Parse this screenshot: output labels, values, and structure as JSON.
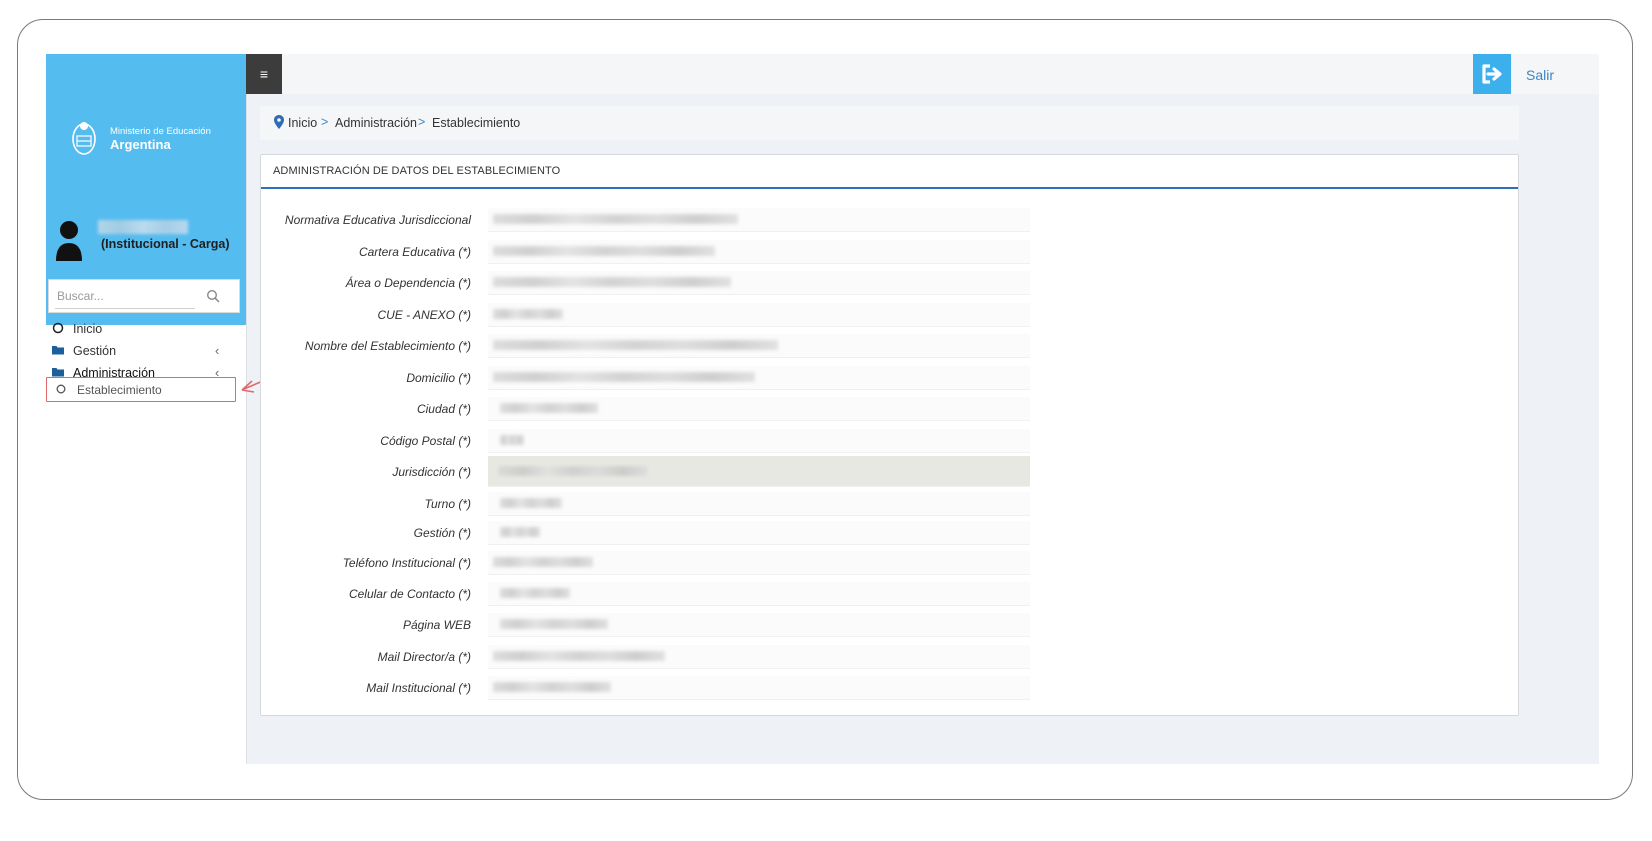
{
  "brand": {
    "line1": "Ministerio de Educación",
    "line2": "Argentina"
  },
  "user": {
    "role": "(Institucional - Carga)"
  },
  "search": {
    "placeholder": "Buscar..."
  },
  "nav": {
    "inicio": "Inicio",
    "gestion": "Gestión",
    "administracion": "Administración",
    "establecimiento": "Establecimiento",
    "chevron": "‹"
  },
  "topbar": {
    "menu_icon": "≡",
    "logout": "Salir"
  },
  "breadcrumb": {
    "items": [
      "Inicio",
      "Administración",
      "Establecimiento"
    ],
    "separator": ">"
  },
  "panel": {
    "title": "ADMINISTRACIÓN DE DATOS DEL ESTABLECIMIENTO",
    "fields": [
      "Normativa Educativa Jurisdiccional",
      "Cartera Educativa (*)",
      "Área o Dependencia (*)",
      "CUE - ANEXO (*)",
      "Nombre del Establecimiento (*)",
      "Domicilio (*)",
      "Ciudad (*)",
      "Código Postal (*)",
      "Jurisdicción (*)",
      "Turno (*)",
      "Gestión (*)",
      "Teléfono Institucional (*)",
      "Celular de Contacto (*)",
      "Página WEB",
      "Mail Director/a (*)",
      "Mail Institucional (*)"
    ]
  },
  "colors": {
    "sidebar_header": "#55bcef",
    "accent": "#2d6fb8",
    "highlight_border": "#e06a6a"
  }
}
